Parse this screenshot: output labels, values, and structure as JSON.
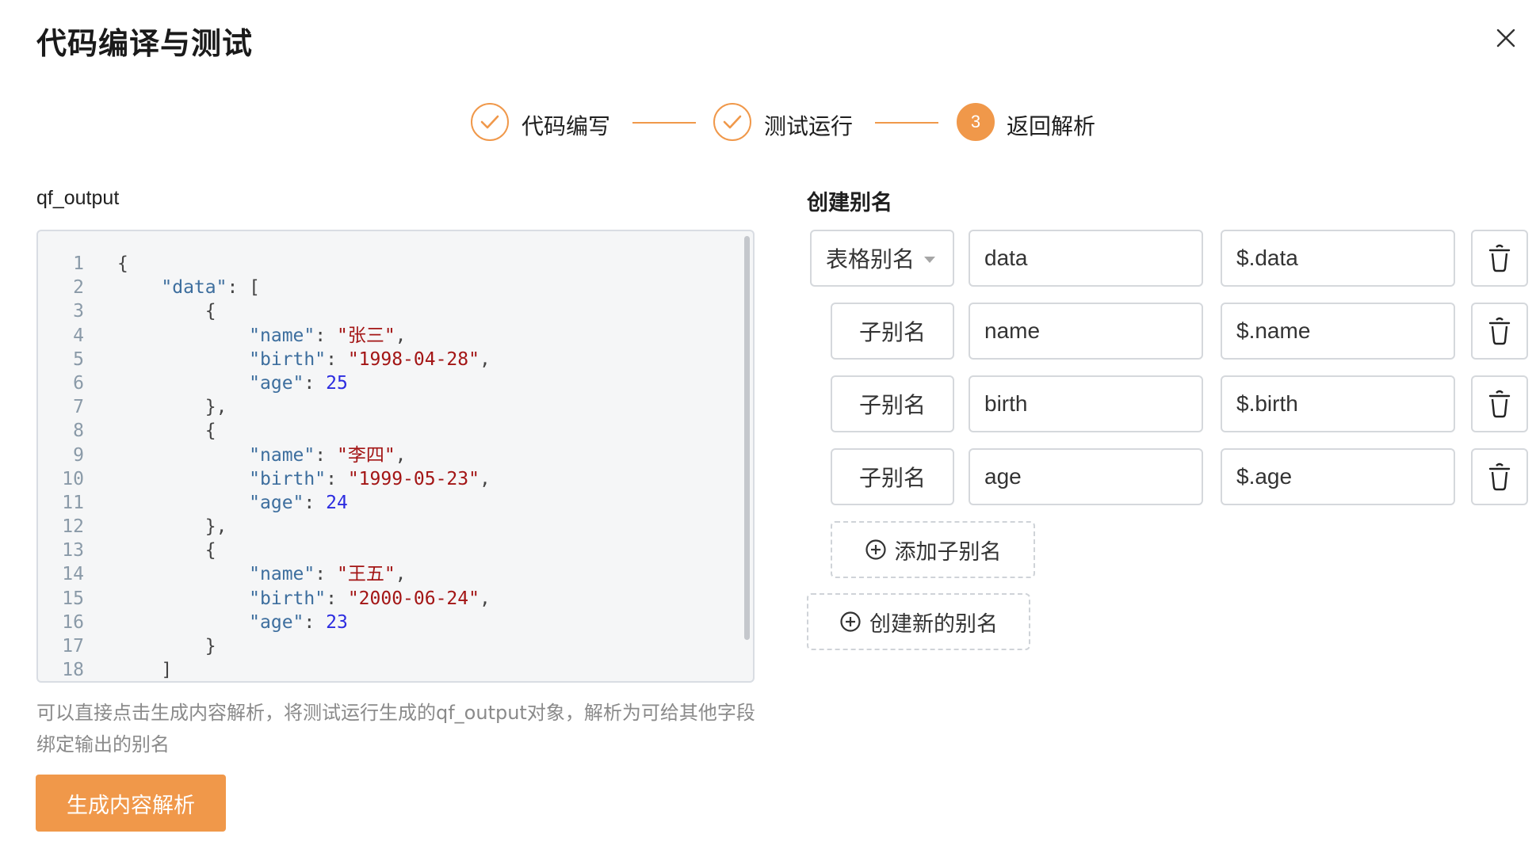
{
  "dialog": {
    "title": "代码编译与测试"
  },
  "steps": [
    {
      "label": "代码编写",
      "status": "done"
    },
    {
      "label": "测试运行",
      "status": "done"
    },
    {
      "label": "返回解析",
      "status": "active",
      "number": "3"
    }
  ],
  "left": {
    "label": "qf_output",
    "code_lines": [
      {
        "n": "1",
        "tokens": [
          [
            "p",
            "{"
          ]
        ]
      },
      {
        "n": "2",
        "tokens": [
          [
            "p",
            "    "
          ],
          [
            "k",
            "\"data\""
          ],
          [
            "p",
            ": ["
          ]
        ]
      },
      {
        "n": "3",
        "tokens": [
          [
            "p",
            "        {"
          ]
        ]
      },
      {
        "n": "4",
        "tokens": [
          [
            "p",
            "            "
          ],
          [
            "k",
            "\"name\""
          ],
          [
            "p",
            ": "
          ],
          [
            "s",
            "\"张三\""
          ],
          [
            "p",
            ","
          ]
        ]
      },
      {
        "n": "5",
        "tokens": [
          [
            "p",
            "            "
          ],
          [
            "k",
            "\"birth\""
          ],
          [
            "p",
            ": "
          ],
          [
            "s",
            "\"1998-04-28\""
          ],
          [
            "p",
            ","
          ]
        ]
      },
      {
        "n": "6",
        "tokens": [
          [
            "p",
            "            "
          ],
          [
            "k",
            "\"age\""
          ],
          [
            "p",
            ": "
          ],
          [
            "n",
            "25"
          ]
        ]
      },
      {
        "n": "7",
        "tokens": [
          [
            "p",
            "        },"
          ]
        ]
      },
      {
        "n": "8",
        "tokens": [
          [
            "p",
            "        {"
          ]
        ]
      },
      {
        "n": "9",
        "tokens": [
          [
            "p",
            "            "
          ],
          [
            "k",
            "\"name\""
          ],
          [
            "p",
            ": "
          ],
          [
            "s",
            "\"李四\""
          ],
          [
            "p",
            ","
          ]
        ]
      },
      {
        "n": "10",
        "tokens": [
          [
            "p",
            "            "
          ],
          [
            "k",
            "\"birth\""
          ],
          [
            "p",
            ": "
          ],
          [
            "s",
            "\"1999-05-23\""
          ],
          [
            "p",
            ","
          ]
        ]
      },
      {
        "n": "11",
        "tokens": [
          [
            "p",
            "            "
          ],
          [
            "k",
            "\"age\""
          ],
          [
            "p",
            ": "
          ],
          [
            "n",
            "24"
          ]
        ]
      },
      {
        "n": "12",
        "tokens": [
          [
            "p",
            "        },"
          ]
        ]
      },
      {
        "n": "13",
        "tokens": [
          [
            "p",
            "        {"
          ]
        ]
      },
      {
        "n": "14",
        "tokens": [
          [
            "p",
            "            "
          ],
          [
            "k",
            "\"name\""
          ],
          [
            "p",
            ": "
          ],
          [
            "s",
            "\"王五\""
          ],
          [
            "p",
            ","
          ]
        ]
      },
      {
        "n": "15",
        "tokens": [
          [
            "p",
            "            "
          ],
          [
            "k",
            "\"birth\""
          ],
          [
            "p",
            ": "
          ],
          [
            "s",
            "\"2000-06-24\""
          ],
          [
            "p",
            ","
          ]
        ]
      },
      {
        "n": "16",
        "tokens": [
          [
            "p",
            "            "
          ],
          [
            "k",
            "\"age\""
          ],
          [
            "p",
            ": "
          ],
          [
            "n",
            "23"
          ]
        ]
      },
      {
        "n": "17",
        "tokens": [
          [
            "p",
            "        }"
          ]
        ]
      },
      {
        "n": "18",
        "tokens": [
          [
            "p",
            "    ]"
          ]
        ]
      }
    ],
    "hint": "可以直接点击生成内容解析，将测试运行生成的qf_output对象，解析为可给其他字段绑定输出的别名",
    "generate_button": "生成内容解析"
  },
  "right": {
    "title": "创建别名",
    "rows": [
      {
        "type_label": "表格别名",
        "has_dropdown": true,
        "name": "data",
        "path": "$.data"
      },
      {
        "type_label": "子别名",
        "has_dropdown": false,
        "name": "name",
        "path": "$.name"
      },
      {
        "type_label": "子别名",
        "has_dropdown": false,
        "name": "birth",
        "path": "$.birth"
      },
      {
        "type_label": "子别名",
        "has_dropdown": false,
        "name": "age",
        "path": "$.age"
      }
    ],
    "add_child_button": "添加子别名",
    "create_alias_button": "创建新的别名"
  },
  "colors": {
    "accent": "#f0984a",
    "border": "#d5d8dc"
  }
}
